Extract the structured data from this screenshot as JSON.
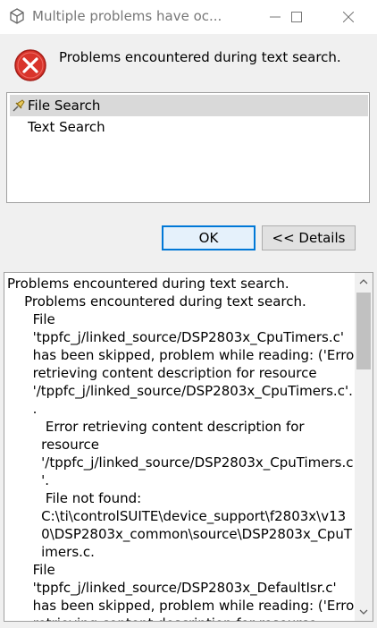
{
  "window": {
    "title": "Multiple problems have oc..."
  },
  "header": {
    "message": "Problems encountered during text search."
  },
  "tree": {
    "items": [
      {
        "label": "File Search",
        "selected": true,
        "icon": "pin-icon"
      },
      {
        "label": "Text Search",
        "selected": false
      }
    ]
  },
  "buttons": {
    "ok_label": "OK",
    "details_label": "<< Details"
  },
  "details": {
    "text": "Problems encountered during text search.\n    Problems encountered during text search.\n      File\n      'tppfc_j/linked_source/DSP2803x_CpuTimers.c'\n      has been skipped, problem while reading: ('Error\n      retrieving content description for resource\n      '/tppfc_j/linked_source/DSP2803x_CpuTimers.c'.')\n      .\n         Error retrieving content description for\n        resource\n        '/tppfc_j/linked_source/DSP2803x_CpuTimers.c\n        '.\n         File not found:\n        C:\\ti\\controlSUITE\\device_support\\f2803x\\v13\n        0\\DSP2803x_common\\source\\DSP2803x_CpuT\n        imers.c.\n      File\n      'tppfc_j/linked_source/DSP2803x_DefaultIsr.c'\n      has been skipped, problem while reading: ('Error\n      retrieving content description for resource"
  },
  "colors": {
    "error_red": "#d9342b",
    "focus_blue": "#0078d7"
  }
}
